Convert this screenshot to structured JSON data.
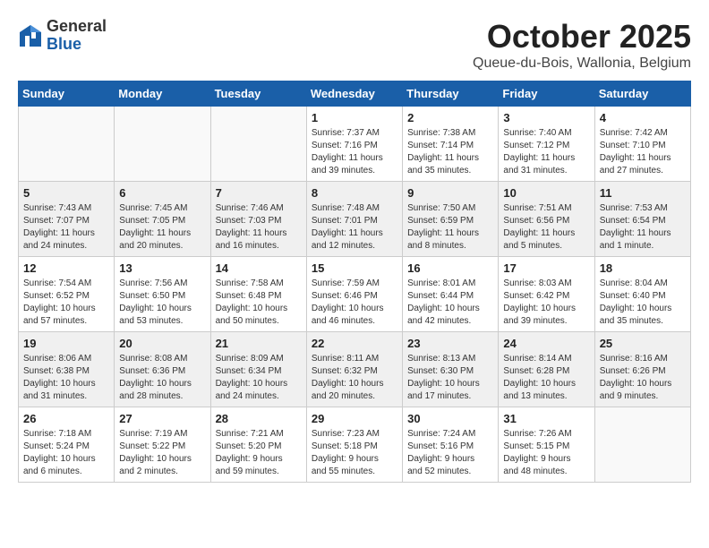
{
  "header": {
    "logo_general": "General",
    "logo_blue": "Blue",
    "month": "October 2025",
    "location": "Queue-du-Bois, Wallonia, Belgium"
  },
  "days_of_week": [
    "Sunday",
    "Monday",
    "Tuesday",
    "Wednesday",
    "Thursday",
    "Friday",
    "Saturday"
  ],
  "weeks": [
    {
      "shaded": false,
      "days": [
        {
          "num": "",
          "info": ""
        },
        {
          "num": "",
          "info": ""
        },
        {
          "num": "",
          "info": ""
        },
        {
          "num": "1",
          "info": "Sunrise: 7:37 AM\nSunset: 7:16 PM\nDaylight: 11 hours\nand 39 minutes."
        },
        {
          "num": "2",
          "info": "Sunrise: 7:38 AM\nSunset: 7:14 PM\nDaylight: 11 hours\nand 35 minutes."
        },
        {
          "num": "3",
          "info": "Sunrise: 7:40 AM\nSunset: 7:12 PM\nDaylight: 11 hours\nand 31 minutes."
        },
        {
          "num": "4",
          "info": "Sunrise: 7:42 AM\nSunset: 7:10 PM\nDaylight: 11 hours\nand 27 minutes."
        }
      ]
    },
    {
      "shaded": true,
      "days": [
        {
          "num": "5",
          "info": "Sunrise: 7:43 AM\nSunset: 7:07 PM\nDaylight: 11 hours\nand 24 minutes."
        },
        {
          "num": "6",
          "info": "Sunrise: 7:45 AM\nSunset: 7:05 PM\nDaylight: 11 hours\nand 20 minutes."
        },
        {
          "num": "7",
          "info": "Sunrise: 7:46 AM\nSunset: 7:03 PM\nDaylight: 11 hours\nand 16 minutes."
        },
        {
          "num": "8",
          "info": "Sunrise: 7:48 AM\nSunset: 7:01 PM\nDaylight: 11 hours\nand 12 minutes."
        },
        {
          "num": "9",
          "info": "Sunrise: 7:50 AM\nSunset: 6:59 PM\nDaylight: 11 hours\nand 8 minutes."
        },
        {
          "num": "10",
          "info": "Sunrise: 7:51 AM\nSunset: 6:56 PM\nDaylight: 11 hours\nand 5 minutes."
        },
        {
          "num": "11",
          "info": "Sunrise: 7:53 AM\nSunset: 6:54 PM\nDaylight: 11 hours\nand 1 minute."
        }
      ]
    },
    {
      "shaded": false,
      "days": [
        {
          "num": "12",
          "info": "Sunrise: 7:54 AM\nSunset: 6:52 PM\nDaylight: 10 hours\nand 57 minutes."
        },
        {
          "num": "13",
          "info": "Sunrise: 7:56 AM\nSunset: 6:50 PM\nDaylight: 10 hours\nand 53 minutes."
        },
        {
          "num": "14",
          "info": "Sunrise: 7:58 AM\nSunset: 6:48 PM\nDaylight: 10 hours\nand 50 minutes."
        },
        {
          "num": "15",
          "info": "Sunrise: 7:59 AM\nSunset: 6:46 PM\nDaylight: 10 hours\nand 46 minutes."
        },
        {
          "num": "16",
          "info": "Sunrise: 8:01 AM\nSunset: 6:44 PM\nDaylight: 10 hours\nand 42 minutes."
        },
        {
          "num": "17",
          "info": "Sunrise: 8:03 AM\nSunset: 6:42 PM\nDaylight: 10 hours\nand 39 minutes."
        },
        {
          "num": "18",
          "info": "Sunrise: 8:04 AM\nSunset: 6:40 PM\nDaylight: 10 hours\nand 35 minutes."
        }
      ]
    },
    {
      "shaded": true,
      "days": [
        {
          "num": "19",
          "info": "Sunrise: 8:06 AM\nSunset: 6:38 PM\nDaylight: 10 hours\nand 31 minutes."
        },
        {
          "num": "20",
          "info": "Sunrise: 8:08 AM\nSunset: 6:36 PM\nDaylight: 10 hours\nand 28 minutes."
        },
        {
          "num": "21",
          "info": "Sunrise: 8:09 AM\nSunset: 6:34 PM\nDaylight: 10 hours\nand 24 minutes."
        },
        {
          "num": "22",
          "info": "Sunrise: 8:11 AM\nSunset: 6:32 PM\nDaylight: 10 hours\nand 20 minutes."
        },
        {
          "num": "23",
          "info": "Sunrise: 8:13 AM\nSunset: 6:30 PM\nDaylight: 10 hours\nand 17 minutes."
        },
        {
          "num": "24",
          "info": "Sunrise: 8:14 AM\nSunset: 6:28 PM\nDaylight: 10 hours\nand 13 minutes."
        },
        {
          "num": "25",
          "info": "Sunrise: 8:16 AM\nSunset: 6:26 PM\nDaylight: 10 hours\nand 9 minutes."
        }
      ]
    },
    {
      "shaded": false,
      "days": [
        {
          "num": "26",
          "info": "Sunrise: 7:18 AM\nSunset: 5:24 PM\nDaylight: 10 hours\nand 6 minutes."
        },
        {
          "num": "27",
          "info": "Sunrise: 7:19 AM\nSunset: 5:22 PM\nDaylight: 10 hours\nand 2 minutes."
        },
        {
          "num": "28",
          "info": "Sunrise: 7:21 AM\nSunset: 5:20 PM\nDaylight: 9 hours\nand 59 minutes."
        },
        {
          "num": "29",
          "info": "Sunrise: 7:23 AM\nSunset: 5:18 PM\nDaylight: 9 hours\nand 55 minutes."
        },
        {
          "num": "30",
          "info": "Sunrise: 7:24 AM\nSunset: 5:16 PM\nDaylight: 9 hours\nand 52 minutes."
        },
        {
          "num": "31",
          "info": "Sunrise: 7:26 AM\nSunset: 5:15 PM\nDaylight: 9 hours\nand 48 minutes."
        },
        {
          "num": "",
          "info": ""
        }
      ]
    }
  ]
}
